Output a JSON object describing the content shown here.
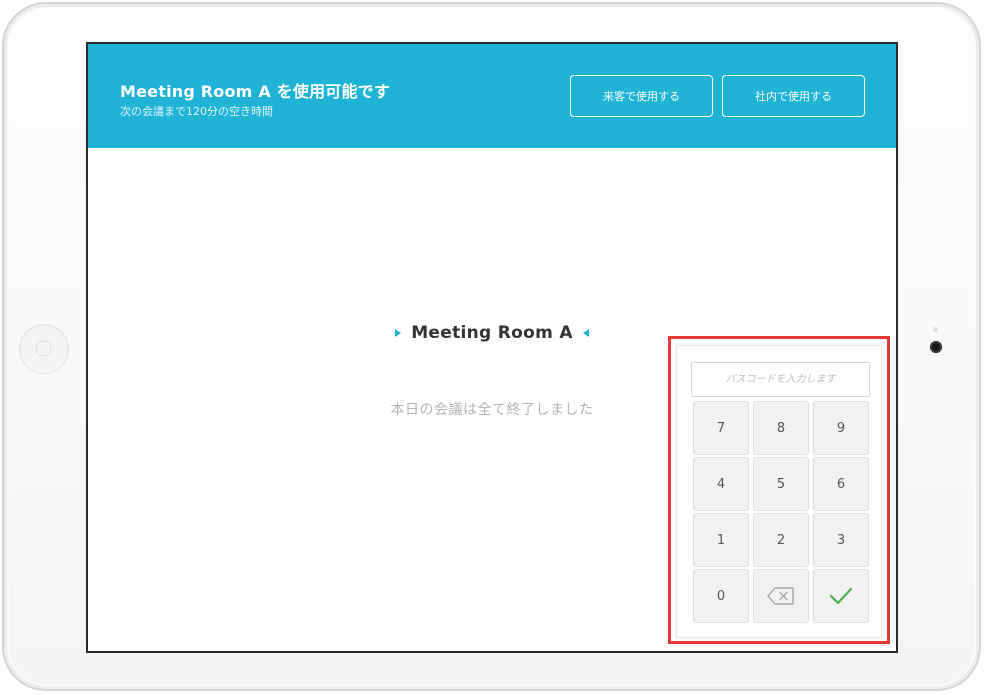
{
  "header": {
    "title": "Meeting Room A を使用可能です",
    "subtitle": "次の会議まで120分の空き時間",
    "guest_button_label": "来客で使用する",
    "internal_button_label": "社内で使用する",
    "background_color": "#1fb4d6"
  },
  "main": {
    "room_name": "Meeting Room A",
    "status_text": "本日の会議は全て終了しました"
  },
  "keypad": {
    "placeholder": "パスコードを入力します",
    "highlight_color": "#e53935",
    "keys": {
      "k7": "7",
      "k8": "8",
      "k9": "9",
      "k4": "4",
      "k5": "5",
      "k6": "6",
      "k1": "1",
      "k2": "2",
      "k3": "3",
      "k0": "0"
    },
    "backspace_icon": "backspace-icon",
    "confirm_icon": "checkmark-icon",
    "confirm_color": "#4caf50"
  }
}
